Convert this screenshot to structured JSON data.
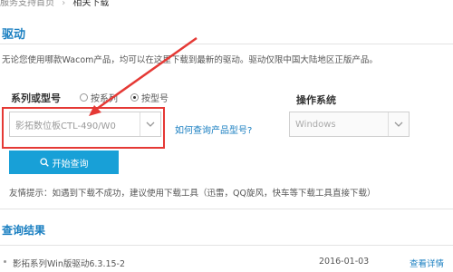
{
  "breadcrumb": {
    "home": "服务支持首页",
    "separator": "›",
    "current": "相关下载"
  },
  "section": {
    "title": "驱动",
    "notice": "无论您使用哪款Wacom产品，均可以在这里下载到最新的驱动。驱动仅限中国大陆地区正版产品。"
  },
  "form": {
    "series_label": "系列或型号",
    "radio_options": [
      {
        "label": "按系列",
        "checked": false
      },
      {
        "label": "按型号",
        "checked": true
      }
    ],
    "model_value": "影拓数位板CTL-490/W0",
    "help_link": "如何查询产品型号?",
    "os_label": "操作系统",
    "os_value": "Windows",
    "search_button": "开始查询",
    "tip": "友情提示：如遇到下载不成功，建议使用下载工具（迅雷，QQ旋风，快车等下载工具直接下载）"
  },
  "results": {
    "title": "查询结果",
    "rows": [
      {
        "name": "影拓系列Win版驱动6.3.15-2",
        "date": "2016-01-03",
        "detail": "查看详情"
      }
    ]
  },
  "colors": {
    "accent": "#1a7fc1",
    "button": "#18a0d7",
    "highlight": "#e53935"
  }
}
